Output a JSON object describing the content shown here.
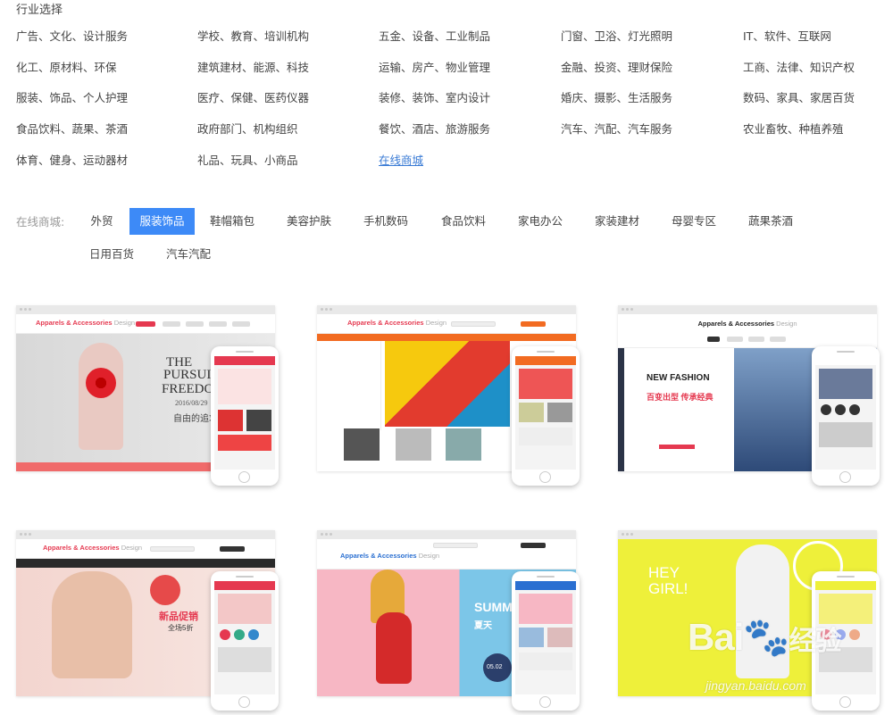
{
  "heading": "行业选择",
  "industries": [
    [
      "广告、文化、设计服务",
      "学校、教育、培训机构",
      "五金、设备、工业制品",
      "门窗、卫浴、灯光照明",
      "IT、软件、互联网"
    ],
    [
      "化工、原材料、环保",
      "建筑建材、能源、科技",
      "运输、房产、物业管理",
      "金融、投资、理财保险",
      "工商、法律、知识产权"
    ],
    [
      "服装、饰品、个人护理",
      "医疗、保健、医药仪器",
      "装修、装饰、室内设计",
      "婚庆、摄影、生活服务",
      "数码、家具、家居百货"
    ],
    [
      "食品饮料、蔬果、茶酒",
      "政府部门、机构组织",
      "餐饮、酒店、旅游服务",
      "汽车、汽配、汽车服务",
      "农业畜牧、种植养殖"
    ],
    [
      "体育、健身、运动器材",
      "礼品、玩具、小商品",
      "在线商城"
    ]
  ],
  "shop": {
    "label": "在线商城:",
    "tabs": [
      "外贸",
      "服装饰品",
      "鞋帽箱包",
      "美容护肤",
      "手机数码",
      "食品饮料",
      "家电办公",
      "家装建材",
      "母婴专区",
      "蔬果茶酒",
      "日用百货",
      "汽车汽配"
    ],
    "active_index": 1
  },
  "templates": {
    "t1": {
      "brand_a": "Apparels & Accessories",
      "brand_b": "Design",
      "line1": "THE",
      "line2": "PURSUI",
      "line3": "FREEDO",
      "date": "2016/08/29",
      "cn": "自由的追求"
    },
    "t2": {
      "brand_a": "Apparels & Accessories",
      "brand_b": "Design"
    },
    "t3": {
      "brand_a": "Apparels & Accessories",
      "brand_b": "Design",
      "title": "NEW FASHION",
      "cn_a": "百变出型",
      "cn_b": "传承经典"
    },
    "t4": {
      "brand_a": "Apparels & Accessories",
      "brand_b": "Design",
      "promo": "新品促销",
      "sub": "全场5折"
    },
    "t5": {
      "brand_a": "Apparels & Accessories",
      "brand_b": "Design",
      "en": "SUMM",
      "cn": "夏天",
      "date": "05.02"
    },
    "t6": {
      "hey": "HEY",
      "girl": "GIRL!"
    }
  },
  "watermark": {
    "text": "Bai",
    "cn": "经验",
    "url": "jingyan.baidu.com"
  },
  "colors": {
    "active_tab": "#3d8af7",
    "link": "#3a7bd5",
    "brand_red": "#e53950"
  }
}
